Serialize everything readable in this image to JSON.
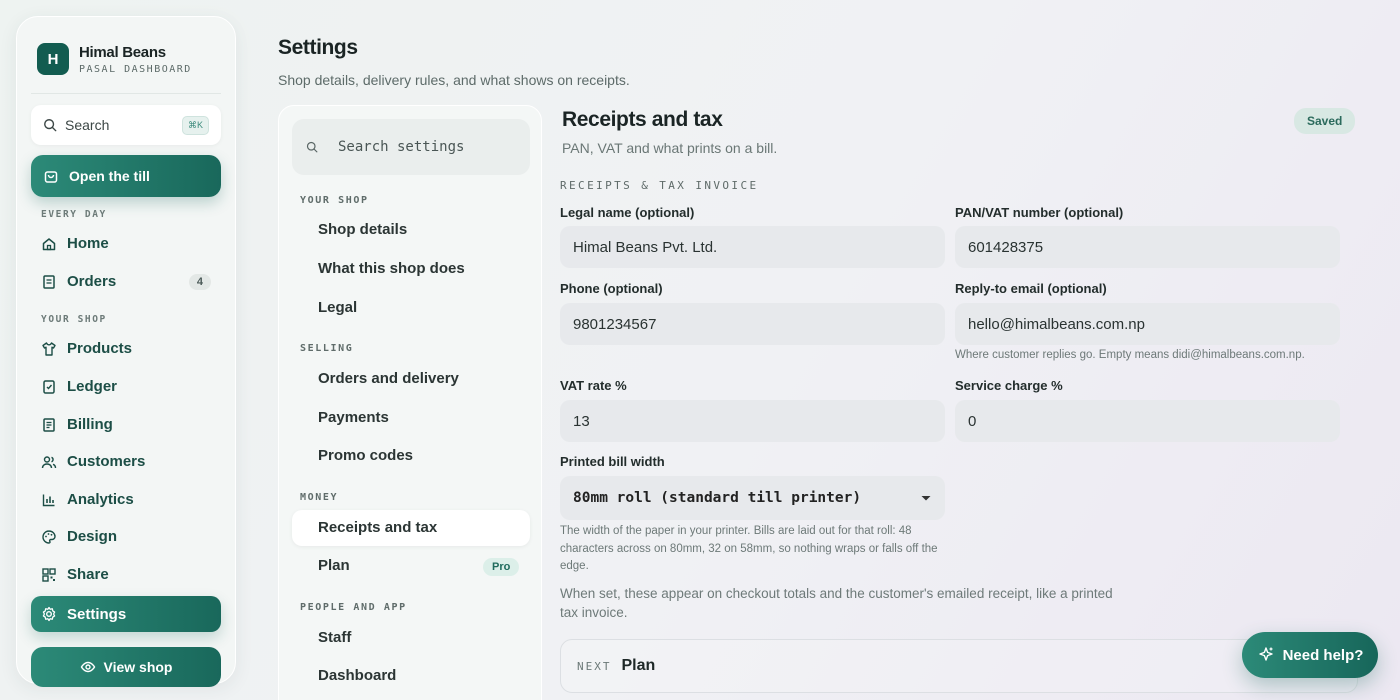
{
  "brand": {
    "initial": "H",
    "name": "Himal Beans",
    "subtitle": "PASAL DASHBOARD"
  },
  "sidebar": {
    "search_label": "Search",
    "search_shortcut": "⌘K",
    "primary_action": "Open the till",
    "sections": [
      "EVERY DAY",
      "YOUR SHOP"
    ],
    "items": [
      {
        "label": "Home",
        "icon": "home-icon"
      },
      {
        "label": "Orders",
        "icon": "receipt-icon",
        "badge": "4"
      },
      {
        "label": "Products",
        "icon": "shirt-icon"
      },
      {
        "label": "Ledger",
        "icon": "ledger-icon"
      },
      {
        "label": "Billing",
        "icon": "bill-icon"
      },
      {
        "label": "Customers",
        "icon": "users-icon"
      },
      {
        "label": "Analytics",
        "icon": "bar-chart-icon"
      },
      {
        "label": "Design",
        "icon": "palette-icon"
      },
      {
        "label": "Share",
        "icon": "qr-icon"
      },
      {
        "label": "Settings",
        "icon": "gear-icon",
        "active": true
      }
    ],
    "view_shop": "View shop"
  },
  "page": {
    "title": "Settings",
    "subtitle": "Shop details, delivery rules, and what shows on receipts."
  },
  "settings_nav": {
    "search_placeholder": "Search settings",
    "sections": [
      {
        "title": "YOUR SHOP",
        "items": [
          "Shop details",
          "What this shop does",
          "Legal"
        ]
      },
      {
        "title": "SELLING",
        "items": [
          "Orders and delivery",
          "Payments",
          "Promo codes"
        ]
      },
      {
        "title": "MONEY",
        "items": [
          "Receipts and tax",
          "Plan"
        ]
      },
      {
        "title": "PEOPLE AND APP",
        "items": [
          "Staff",
          "Dashboard"
        ]
      }
    ],
    "active": "Receipts and tax",
    "plan_badge": "Pro"
  },
  "content": {
    "title": "Receipts and tax",
    "subtitle": "PAN, VAT and what prints on a bill.",
    "status": "Saved",
    "group_label": "RECEIPTS & TAX INVOICE",
    "fields": {
      "legal_name": {
        "label": "Legal name (optional)",
        "value": "Himal Beans Pvt. Ltd."
      },
      "pan_vat": {
        "label": "PAN/VAT number (optional)",
        "value": "601428375"
      },
      "phone": {
        "label": "Phone (optional)",
        "value": "9801234567"
      },
      "reply_email": {
        "label": "Reply-to email (optional)",
        "value": "hello@himalbeans.com.np",
        "hint": "Where customer replies go. Empty means didi@himalbeans.com.np."
      },
      "vat_rate": {
        "label": "VAT rate %",
        "value": "13"
      },
      "service_charge": {
        "label": "Service charge %",
        "value": "0"
      },
      "bill_width": {
        "label": "Printed bill width",
        "value": "80mm roll (standard till printer)",
        "hint": "The width of the paper in your printer. Bills are laid out for that roll: 48 characters across on 80mm, 32 on 58mm, so nothing wraps or falls off the edge."
      }
    },
    "note": "When set, these appear on checkout totals and the customer's emailed receipt, like a printed tax invoice.",
    "next_label": "NEXT",
    "next_value": "Plan"
  },
  "help": {
    "label": "Need help?"
  },
  "colors": {
    "accent": "#1f7a6a",
    "accent_dark": "#125c50",
    "badge_bg": "#dcefe9"
  }
}
